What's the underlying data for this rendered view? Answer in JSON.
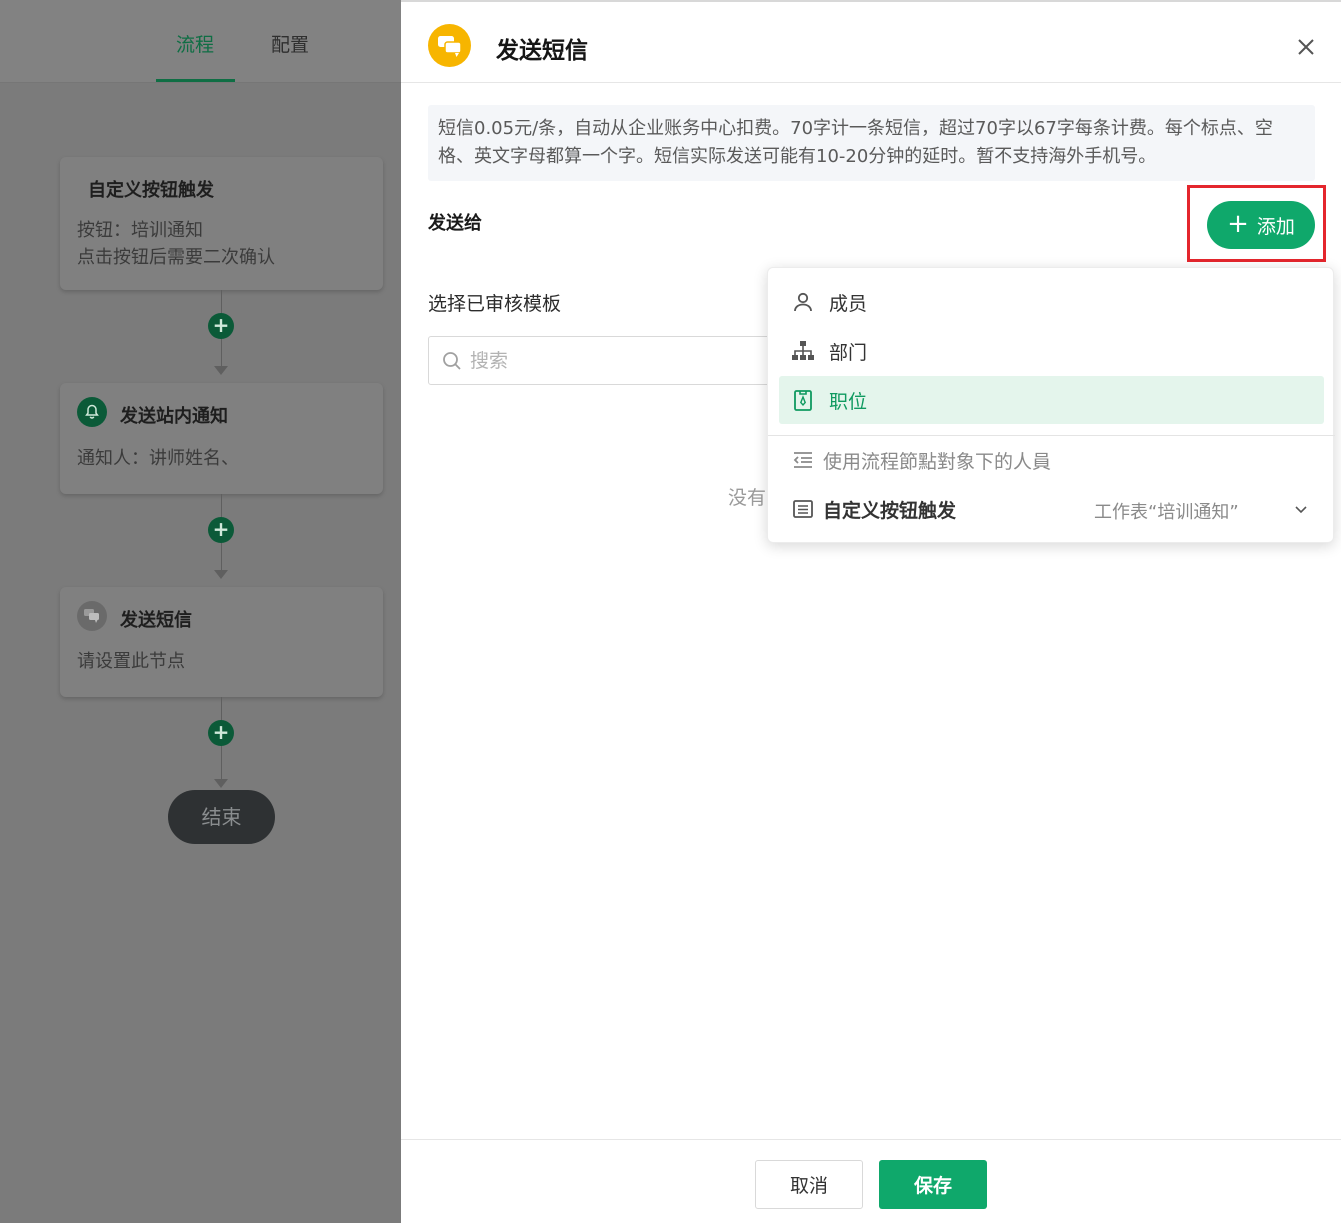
{
  "left_panel": {
    "tabs": [
      {
        "label": "流程",
        "active": true
      },
      {
        "label": "配置",
        "active": false
      }
    ],
    "nodes": [
      {
        "title": "自定义按钮触发",
        "lines": [
          "按钮：培训通知",
          "点击按钮后需要二次确认"
        ]
      },
      {
        "title": "发送站内通知",
        "icon": "bell-icon",
        "lines": [
          "通知人：讲师姓名、"
        ]
      },
      {
        "title": "发送短信",
        "icon": "chat-bubbles-icon",
        "lines": [
          "请设置此节点"
        ]
      }
    ],
    "add_node_symbol": "+",
    "end_label": "结束"
  },
  "drawer": {
    "title": "发送短信",
    "title_icon": "chat-bubbles-icon",
    "notice": "短信0.05元/条，自动从企业账务中心扣费。70字计一条短信，超过70字以67字每条计费。每个标点、空格、英文字母都算一个字。短信实际发送可能有10-20分钟的延时。暂不支持海外手机号。",
    "send_to_label": "发送给",
    "add_button_label": "添加",
    "template_label": "选择已审核模板",
    "search": {
      "placeholder": "搜索",
      "value": ""
    },
    "empty_text": "没有",
    "dropdown": {
      "items": [
        {
          "label": "成员",
          "icon": "user-icon"
        },
        {
          "label": "部门",
          "icon": "org-chart-icon"
        },
        {
          "label": "职位",
          "icon": "badge-icon",
          "selected": true
        }
      ],
      "flow_users_label": "使用流程節點對象下的人員",
      "trigger": {
        "label": "自定义按钮触发",
        "sheet": "工作表“培训通知”"
      }
    },
    "footer": {
      "cancel": "取消",
      "save": "保存"
    }
  },
  "colors": {
    "accent": "#0fa86b",
    "highlight": "#e4262d",
    "title_icon_bg": "#f7b500",
    "selected_bg": "#e4f5ec"
  }
}
